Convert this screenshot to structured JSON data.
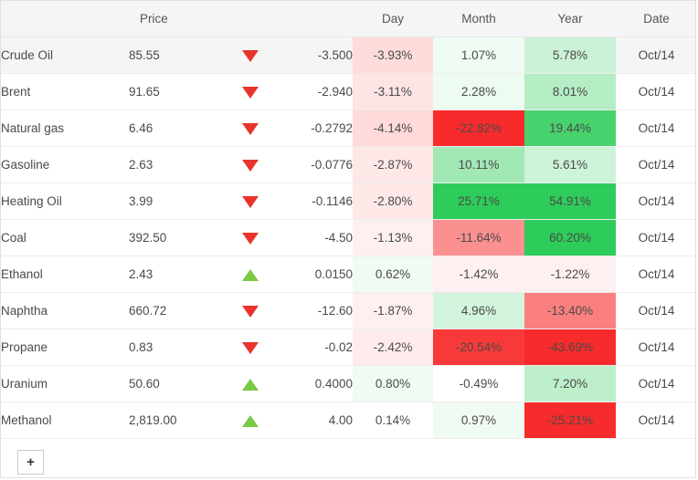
{
  "table": {
    "columns": [
      {
        "key": "name",
        "label": ""
      },
      {
        "key": "price",
        "label": "Price"
      },
      {
        "key": "arrow",
        "label": ""
      },
      {
        "key": "change",
        "label": ""
      },
      {
        "key": "day",
        "label": "Day"
      },
      {
        "key": "month",
        "label": "Month"
      },
      {
        "key": "year",
        "label": "Year"
      },
      {
        "key": "date",
        "label": "Date"
      }
    ],
    "rows": [
      {
        "name": "Crude Oil",
        "price": "85.55",
        "direction": "down",
        "change": "-3.500",
        "day": "-3.93%",
        "month": "1.07%",
        "year": "5.78%",
        "date": "Oct/14",
        "day_val": -3.93,
        "month_val": 1.07,
        "year_val": 5.78,
        "highlighted": true
      },
      {
        "name": "Brent",
        "price": "91.65",
        "direction": "down",
        "change": "-2.940",
        "day": "-3.11%",
        "month": "2.28%",
        "year": "8.01%",
        "date": "Oct/14",
        "day_val": -3.11,
        "month_val": 2.28,
        "year_val": 8.01,
        "highlighted": false
      },
      {
        "name": "Natural gas",
        "price": "6.46",
        "direction": "down",
        "change": "-0.2792",
        "day": "-4.14%",
        "month": "-22.82%",
        "year": "19.44%",
        "date": "Oct/14",
        "day_val": -4.14,
        "month_val": -22.82,
        "year_val": 19.44,
        "highlighted": false
      },
      {
        "name": "Gasoline",
        "price": "2.63",
        "direction": "down",
        "change": "-0.0776",
        "day": "-2.87%",
        "month": "10.11%",
        "year": "5.61%",
        "date": "Oct/14",
        "day_val": -2.87,
        "month_val": 10.11,
        "year_val": 5.61,
        "highlighted": false
      },
      {
        "name": "Heating Oil",
        "price": "3.99",
        "direction": "down",
        "change": "-0.1146",
        "day": "-2.80%",
        "month": "25.71%",
        "year": "54.91%",
        "date": "Oct/14",
        "day_val": -2.8,
        "month_val": 25.71,
        "year_val": 54.91,
        "highlighted": false
      },
      {
        "name": "Coal",
        "price": "392.50",
        "direction": "down",
        "change": "-4.50",
        "day": "-1.13%",
        "month": "-11.64%",
        "year": "60.20%",
        "date": "Oct/14",
        "day_val": -1.13,
        "month_val": -11.64,
        "year_val": 60.2,
        "highlighted": false
      },
      {
        "name": "Ethanol",
        "price": "2.43",
        "direction": "up",
        "change": "0.0150",
        "day": "0.62%",
        "month": "-1.42%",
        "year": "-1.22%",
        "date": "Oct/14",
        "day_val": 0.62,
        "month_val": -1.42,
        "year_val": -1.22,
        "highlighted": false
      },
      {
        "name": "Naphtha",
        "price": "660.72",
        "direction": "down",
        "change": "-12.60",
        "day": "-1.87%",
        "month": "4.96%",
        "year": "-13.40%",
        "date": "Oct/14",
        "day_val": -1.87,
        "month_val": 4.96,
        "year_val": -13.4,
        "highlighted": false
      },
      {
        "name": "Propane",
        "price": "0.83",
        "direction": "down",
        "change": "-0.02",
        "day": "-2.42%",
        "month": "-20.54%",
        "year": "-43.69%",
        "date": "Oct/14",
        "day_val": -2.42,
        "month_val": -20.54,
        "year_val": -43.69,
        "highlighted": false
      },
      {
        "name": "Uranium",
        "price": "50.60",
        "direction": "up",
        "change": "0.4000",
        "day": "0.80%",
        "month": "-0.49%",
        "year": "7.20%",
        "date": "Oct/14",
        "day_val": 0.8,
        "month_val": -0.49,
        "year_val": 7.2,
        "highlighted": false
      },
      {
        "name": "Methanol",
        "price": "2,819.00",
        "direction": "up",
        "change": "4.00",
        "day": "0.14%",
        "month": "0.97%",
        "year": "-25.21%",
        "date": "Oct/14",
        "day_val": 0.14,
        "month_val": 0.97,
        "year_val": -25.21,
        "highlighted": false
      }
    ]
  },
  "footer": {
    "add_label": "+"
  },
  "colors": {
    "negative": "#f72b2b",
    "positive": "#2ecc5a",
    "arrow_down": "#e8342c",
    "arrow_up": "#7ac943",
    "header_bg": "#f5f5f5",
    "row_highlight_bg": "#f5f5f5",
    "border": "#ededed",
    "text": "#4a4a4a"
  }
}
